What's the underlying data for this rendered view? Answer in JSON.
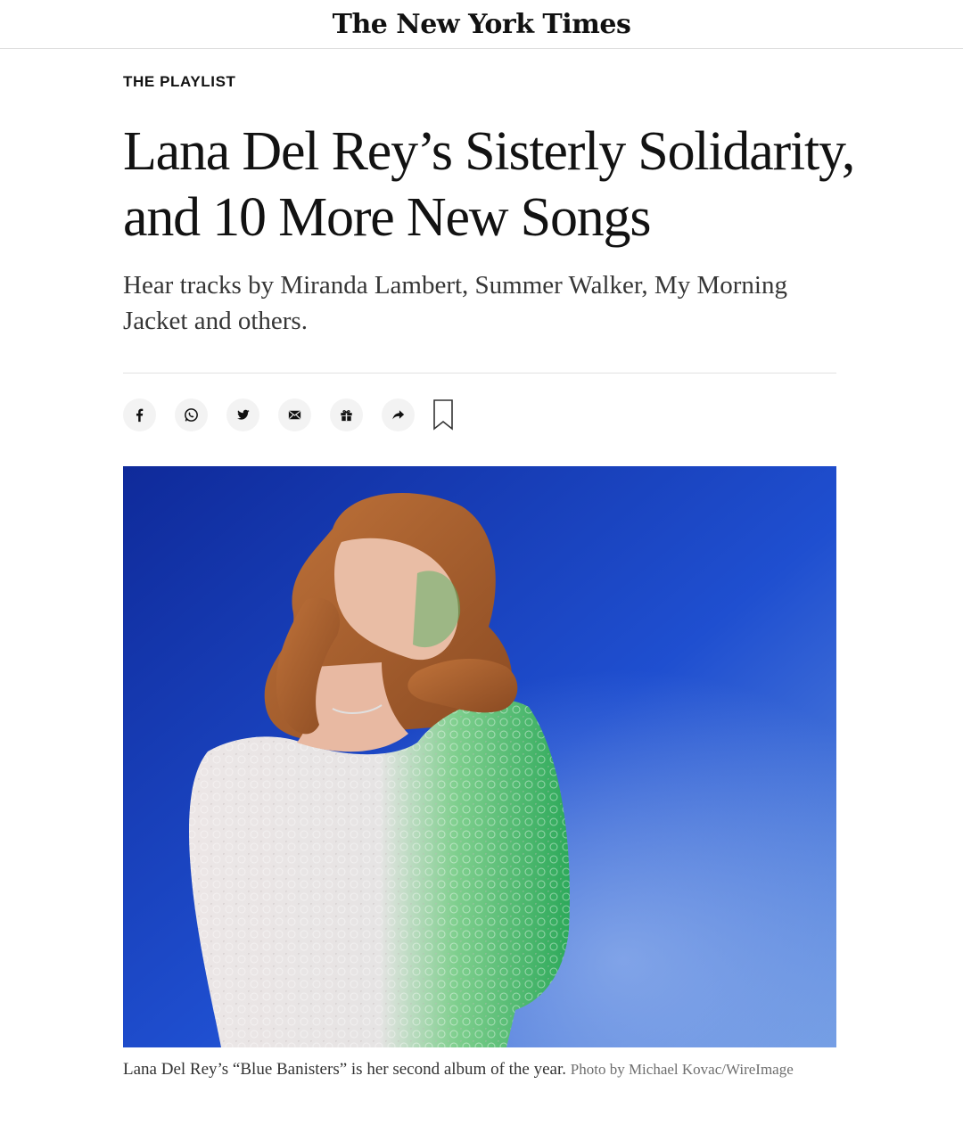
{
  "masthead": {
    "logo_text": "The New York Times"
  },
  "article": {
    "kicker": "THE PLAYLIST",
    "headline": "Lana Del Rey’s Sisterly Solidarity, and 10 More New Songs",
    "summary": "Hear tracks by Miranda Lambert, Summer Walker, My Morning Jacket and others.",
    "caption": "Lana Del Rey’s “Blue Banisters” is her second album of the year.",
    "credit": "Photo by Michael Kovac/WireImage"
  },
  "share": {
    "icons": [
      "facebook-icon",
      "whatsapp-icon",
      "twitter-icon",
      "email-icon",
      "gift-icon",
      "share-arrow-icon",
      "bookmark-icon"
    ]
  },
  "colors": {
    "photo_background": "#1f49c4",
    "share_button_bg": "#f3f3f3"
  }
}
